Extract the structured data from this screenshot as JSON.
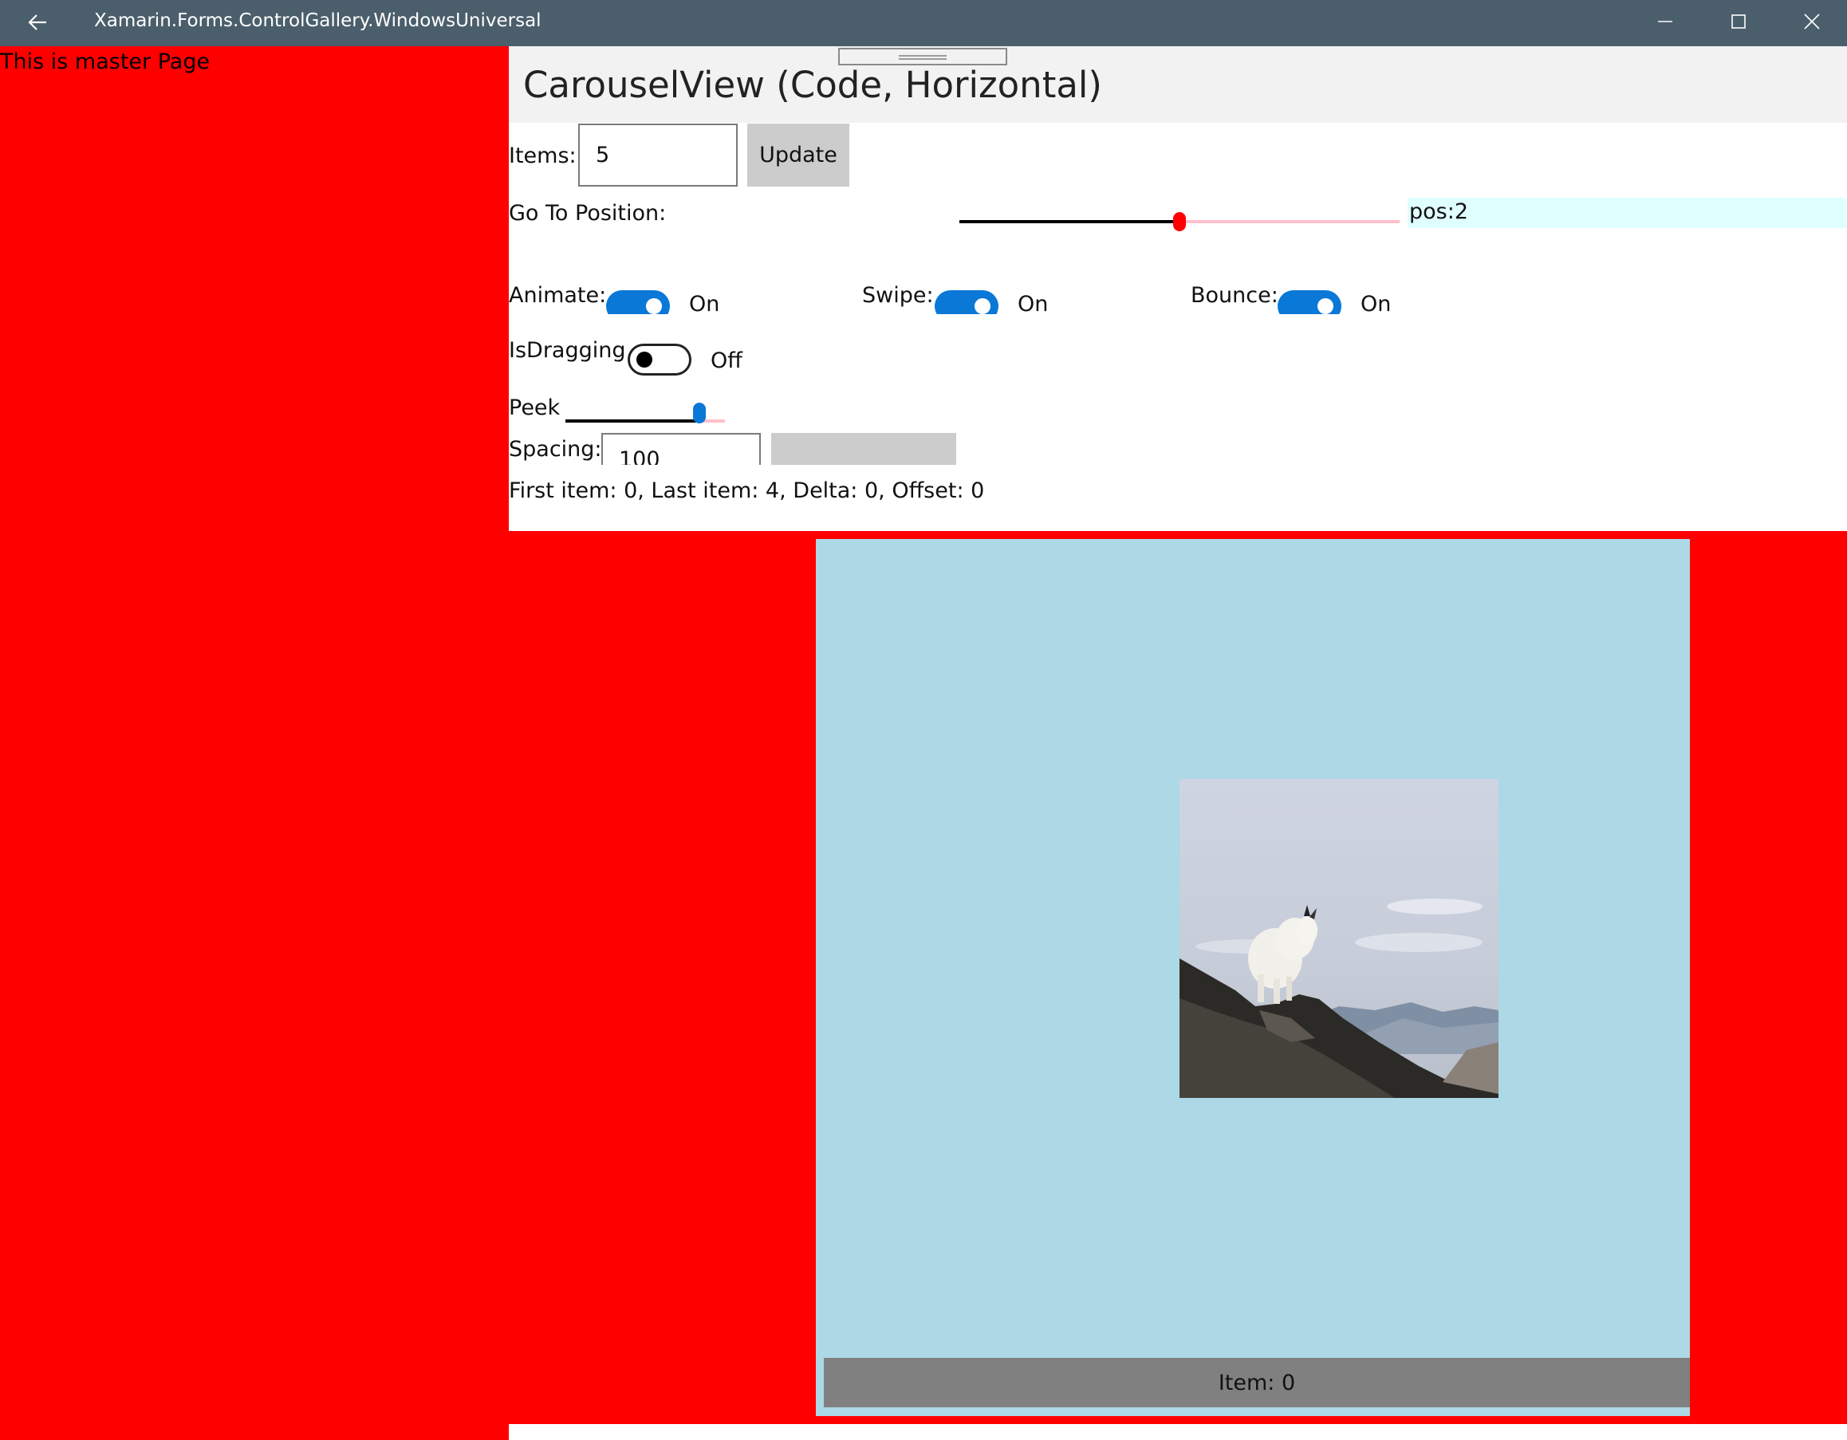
{
  "window": {
    "title": "Xamarin.Forms.ControlGallery.WindowsUniversal",
    "back_icon": "back-arrow-icon",
    "minimize_icon": "minimize-icon",
    "maximize_icon": "maximize-icon",
    "close_icon": "close-icon"
  },
  "master": {
    "text": "This is master Page",
    "background": "#ff0000"
  },
  "detail": {
    "title": "CarouselView (Code, Horizontal)"
  },
  "controls": {
    "items_label": "Items:",
    "items_value": "5",
    "update_label": "Update",
    "go_to_label": "Go To Position:",
    "position_text": "pos:2",
    "position_value": 2,
    "position_max": 4,
    "animate_label": "Animate:",
    "animate_state": "On",
    "swipe_label": "Swipe:",
    "swipe_state": "On",
    "bounce_label": "Bounce:",
    "bounce_state": "On",
    "isdragging_label": "IsDragging",
    "isdragging_state": "Off",
    "peek_label": "Peek",
    "spacing_label": "Spacing:",
    "spacing_value": "100",
    "status_text": "First item: 0, Last item: 4, Delta: 0, Offset: 0"
  },
  "carousel": {
    "item_label": "Item: 0",
    "card_color": "#add8e6",
    "footer_color": "#808080"
  },
  "colors": {
    "titlebar": "#4b5e6b",
    "accent": "#0a78d7",
    "slider_thumb": "#ff0000",
    "pos_label_bg": "#e0ffff"
  }
}
